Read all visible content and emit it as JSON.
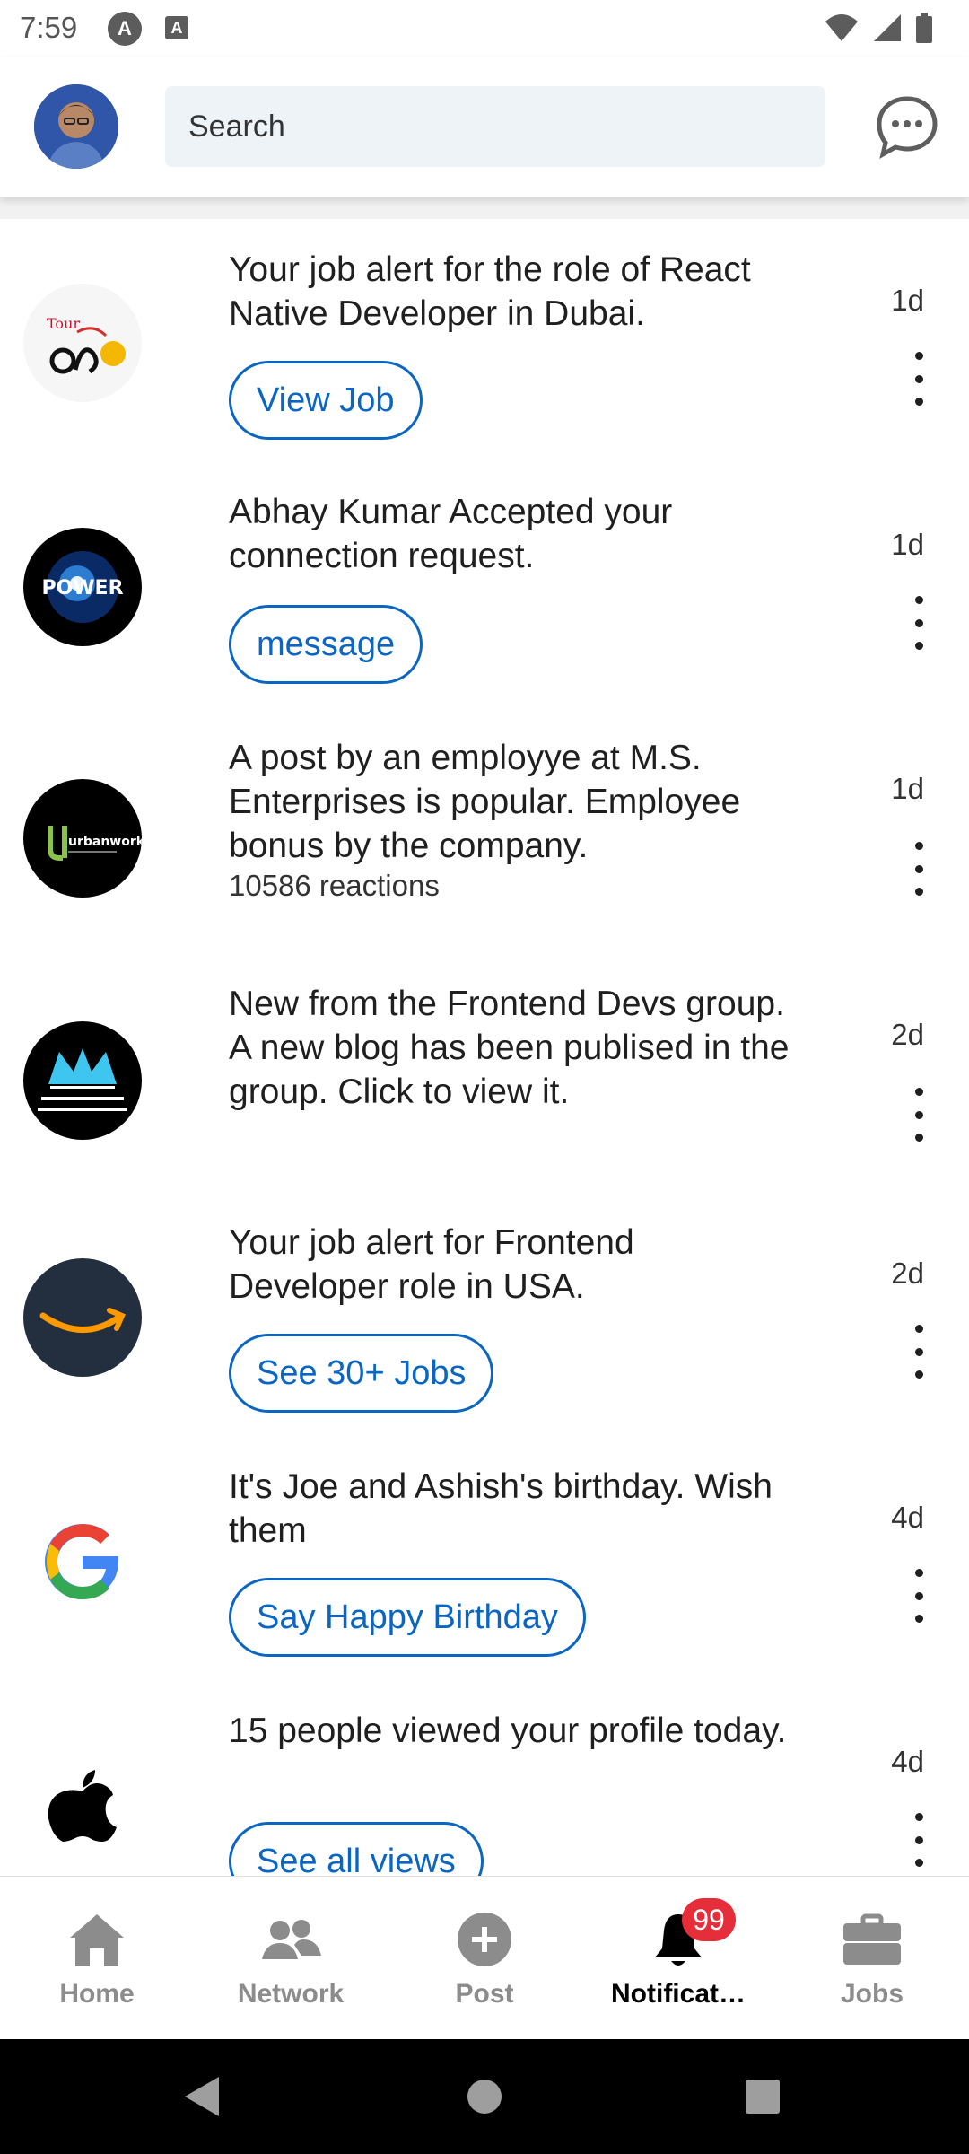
{
  "status_bar": {
    "time": "7:59",
    "icon_a": "A",
    "icon_b": "A"
  },
  "header": {
    "search_placeholder": "Search"
  },
  "notifications": [
    {
      "text": "Your job alert for the role of React Native Developer in Dubai.",
      "time": "1d",
      "button": "View Job",
      "logo": "tour-logo"
    },
    {
      "text": "Abhay Kumar Accepted your connection request.",
      "time": "1d",
      "button": "message",
      "logo": "power-logo"
    },
    {
      "text": "A post by an employye at M.S. Enterprises is popular. Employee bonus by the company.",
      "time": "1d",
      "sub": "10586 reactions",
      "logo": "urbanworks-logo",
      "logo_text": "urbanworks"
    },
    {
      "text": "New from the Frontend Devs group. A new blog has been publised in the group. Click to view it.",
      "time": "2d",
      "logo": "frontend-devs-logo"
    },
    {
      "text": "Your job alert for Frontend Developer role in USA.",
      "time": "2d",
      "button": "See 30+ Jobs",
      "logo": "amazon-logo"
    },
    {
      "text": "It's Joe and Ashish's birthday. Wish them",
      "time": "4d",
      "button": "Say Happy Birthday",
      "logo": "google-logo"
    },
    {
      "text": "15 people viewed your profile today.",
      "time": "4d",
      "button": "See all views",
      "logo": "apple-logo"
    }
  ],
  "logos": {
    "power": "POWER"
  },
  "bottom_nav": [
    {
      "label": "Home",
      "icon": "home-icon"
    },
    {
      "label": "Network",
      "icon": "network-icon"
    },
    {
      "label": "Post",
      "icon": "post-icon"
    },
    {
      "label": "Notificat…",
      "icon": "bell-icon",
      "badge": "99",
      "active": true
    },
    {
      "label": "Jobs",
      "icon": "briefcase-icon"
    }
  ],
  "colors": {
    "accent": "#0a66c2",
    "badge": "#e62e3b",
    "inactive": "#8c8c8c"
  }
}
